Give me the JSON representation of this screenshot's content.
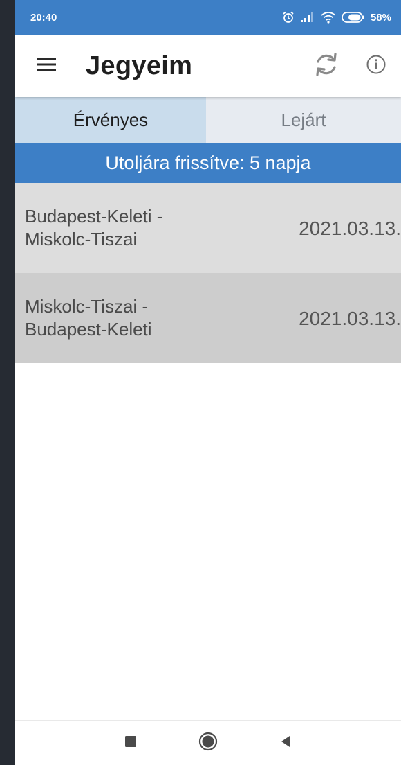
{
  "status_bar": {
    "time": "20:40",
    "battery_percent": "58%",
    "icons": [
      "alarm-icon",
      "signal-icon",
      "wifi-icon",
      "battery-icon"
    ]
  },
  "app_bar": {
    "title": "Jegyeim",
    "icons": [
      "menu-icon",
      "refresh-icon",
      "info-icon"
    ]
  },
  "tabs": [
    {
      "label": "Érvényes",
      "active": true
    },
    {
      "label": "Lejárt",
      "active": false
    }
  ],
  "banner": {
    "text": "Utoljára frissítve: 5 napja"
  },
  "tickets": [
    {
      "from": "Budapest-Keleti -",
      "to": "Miskolc-Tiszai",
      "date": "2021.03.13."
    },
    {
      "from": "Miskolc-Tiszai -",
      "to": "Budapest-Keleti",
      "date": "2021.03.13."
    }
  ],
  "nav_bar": {
    "icons": [
      "recents-square-icon",
      "home-circle-icon",
      "back-triangle-icon"
    ]
  },
  "colors": {
    "primary": "#3d7fc6",
    "tab_active": "#c9dcec",
    "tab_inactive": "#e7ebf1",
    "row_odd": "#dddddd",
    "row_even": "#cdcdcd"
  }
}
